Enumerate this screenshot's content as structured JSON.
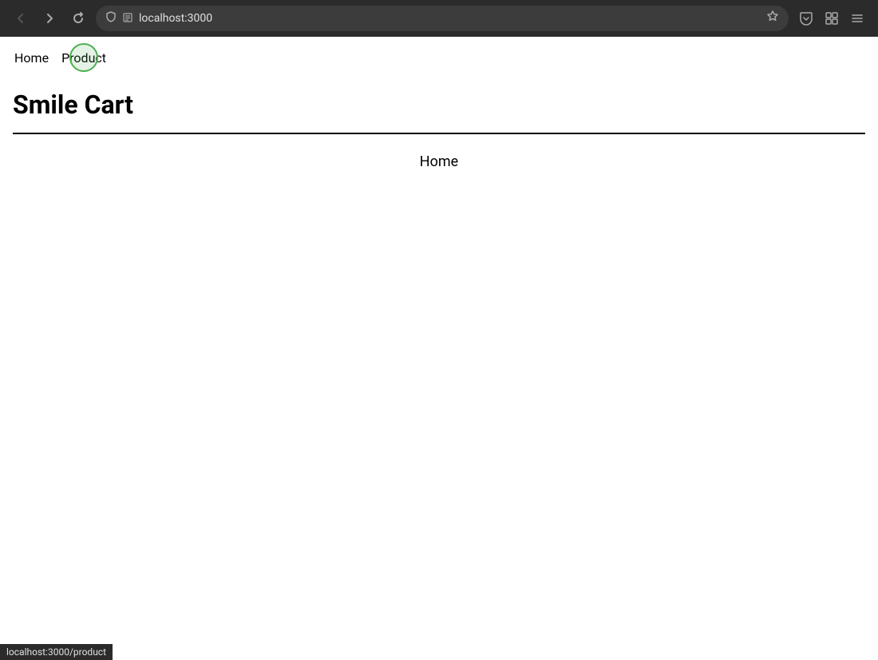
{
  "browser": {
    "url": "localhost:3000",
    "back_button": "◀",
    "forward_button": "▶",
    "refresh_button": "↺",
    "star_icon": "☆",
    "shield_icon": "🛡",
    "menu_icon": "≡",
    "extensions_icon": "🧩",
    "pocket_icon": "🅟"
  },
  "nav": {
    "home_label": "Home",
    "product_label": "Product"
  },
  "site": {
    "title": "Smile Cart",
    "content_text": "Home"
  },
  "status_bar": {
    "url": "localhost:3000/product"
  }
}
